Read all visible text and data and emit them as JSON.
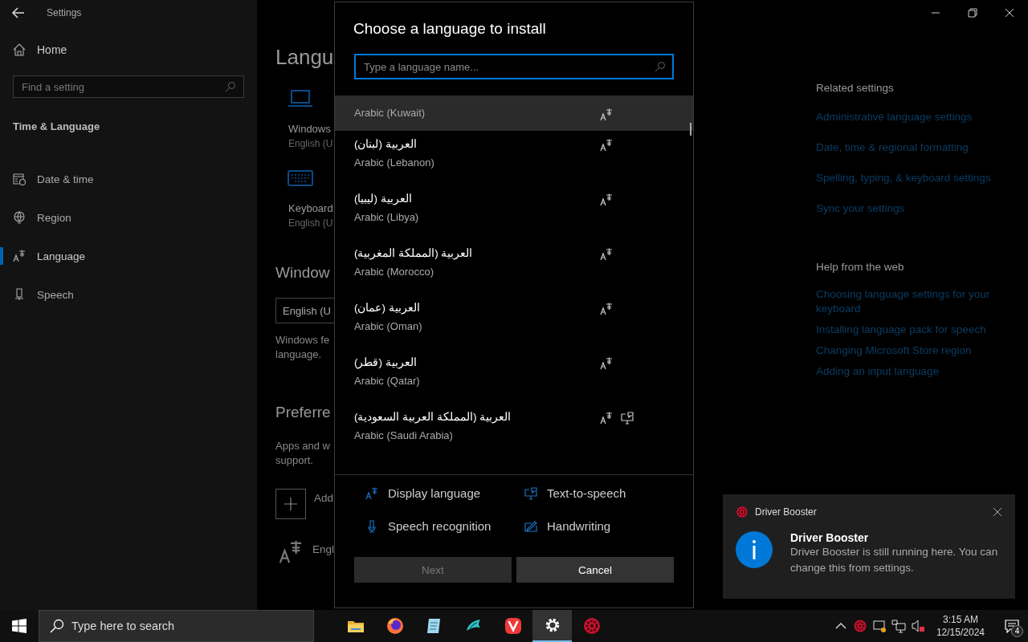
{
  "window": {
    "title": "Settings"
  },
  "sidebar": {
    "home": "Home",
    "search": {
      "placeholder": "Find a setting"
    },
    "section": "Time & Language",
    "items": [
      {
        "label": "Date & time",
        "selected": false
      },
      {
        "label": "Region",
        "selected": false
      },
      {
        "label": "Language",
        "selected": true
      },
      {
        "label": "Speech",
        "selected": false
      }
    ]
  },
  "main": {
    "heading": "Langu",
    "items": [
      {
        "title": "Windows",
        "subtitle": "English (U"
      },
      {
        "title": "Keyboard",
        "subtitle": "English (U"
      }
    ],
    "display_heading": "Window",
    "dropdown": "English (U",
    "display_note": [
      "Windows fe",
      "language."
    ],
    "preferred_heading": "Preferre",
    "preferred_note": [
      "Apps and w",
      "support."
    ],
    "add_label": "Add",
    "language_label": "Engl"
  },
  "related": {
    "title": "Related settings",
    "links": [
      "Administrative language settings",
      "Date, time & regional formatting",
      "Spelling, typing, & keyboard settings",
      "Sync your settings"
    ]
  },
  "help": {
    "title": "Help from the web",
    "links": [
      "Choosing language settings for your keyboard",
      "Installing language pack for speech",
      "Changing Microsoft Store region",
      "Adding an input language"
    ]
  },
  "dialog": {
    "title": "Choose a language to install",
    "search": {
      "placeholder": "Type a language name..."
    },
    "languages": [
      {
        "english": "Arabic (Kuwait)",
        "display_language": true,
        "text_to_speech": false,
        "highlighted": true
      },
      {
        "native": "العربية (لبنان)",
        "english": "Arabic (Lebanon)",
        "display_language": true,
        "text_to_speech": false,
        "highlighted": false
      },
      {
        "native": "العربية (ليبيا)",
        "english": "Arabic (Libya)",
        "display_language": true,
        "text_to_speech": false,
        "highlighted": false
      },
      {
        "native": "العربية (المملكة المغربية)",
        "english": "Arabic (Morocco)",
        "display_language": true,
        "text_to_speech": false,
        "highlighted": false
      },
      {
        "native": "العربية (عمان)",
        "english": "Arabic (Oman)",
        "display_language": true,
        "text_to_speech": false,
        "highlighted": false
      },
      {
        "native": "العربية (قطر)",
        "english": "Arabic (Qatar)",
        "display_language": true,
        "text_to_speech": false,
        "highlighted": false
      },
      {
        "native": "العربية (المملكة العربية السعودية)",
        "english": "Arabic (Saudi Arabia)",
        "display_language": true,
        "text_to_speech": true,
        "highlighted": false
      }
    ],
    "legend": [
      {
        "kind": "display",
        "label": "Display language"
      },
      {
        "kind": "tts",
        "label": "Text-to-speech"
      },
      {
        "kind": "speech",
        "label": "Speech recognition"
      },
      {
        "kind": "handwriting",
        "label": "Handwriting"
      }
    ],
    "buttons": [
      {
        "label": "Next",
        "disabled": true
      },
      {
        "label": "Cancel",
        "disabled": false
      }
    ]
  },
  "toast": {
    "app": "Driver Booster",
    "title": "Driver Booster",
    "message": "Driver Booster is still running here. You can change this from settings."
  },
  "taskbar": {
    "search": {
      "placeholder": "Type here to search"
    },
    "apps": [
      {
        "kind": "folder",
        "active": false
      },
      {
        "kind": "firefox",
        "active": false
      },
      {
        "kind": "notepad",
        "active": false
      },
      {
        "kind": "bird",
        "active": false
      },
      {
        "kind": "vivaldi",
        "active": false
      },
      {
        "kind": "settings",
        "active": true
      },
      {
        "kind": "booster",
        "active": false
      }
    ],
    "clock": {
      "time": "3:15 AM",
      "date": "12/15/2024"
    },
    "notifications": "4"
  }
}
